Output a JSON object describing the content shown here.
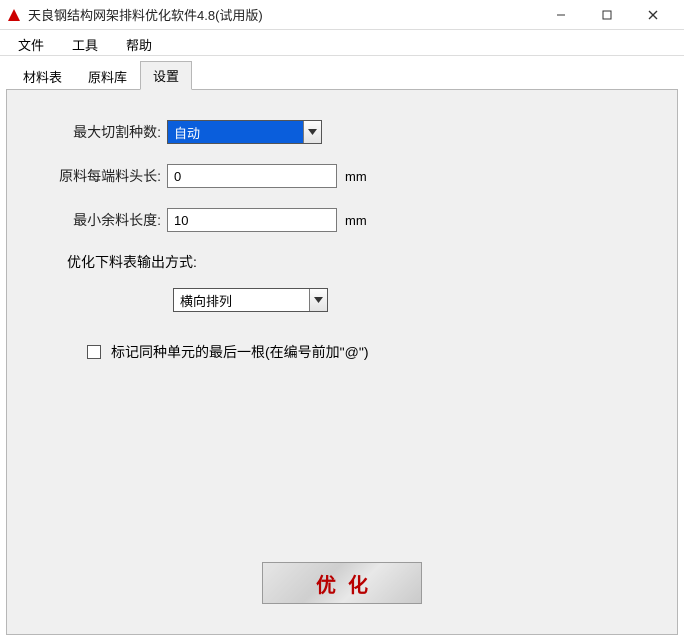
{
  "window": {
    "title": "天良钢结构网架排料优化软件4.8(试用版)"
  },
  "menu": {
    "items": [
      "文件",
      "工具",
      "帮助"
    ]
  },
  "tabs": {
    "items": [
      "材料表",
      "原料库",
      "设置"
    ],
    "activeIndex": 2
  },
  "form": {
    "maxCutKinds": {
      "label": "最大切割种数:",
      "value": "自动"
    },
    "headerLen": {
      "label": "原料每端料头长:",
      "value": "0",
      "unit": "mm"
    },
    "minLeftLen": {
      "label": "最小余料长度:",
      "value": "10",
      "unit": "mm"
    },
    "outputModeLabel": "优化下料表输出方式:",
    "outputMode": {
      "value": "横向排列"
    },
    "markLast": {
      "label": "标记同种单元的最后一根(在编号前加\"@\")",
      "checked": false
    }
  },
  "actions": {
    "optimize": "优化"
  }
}
